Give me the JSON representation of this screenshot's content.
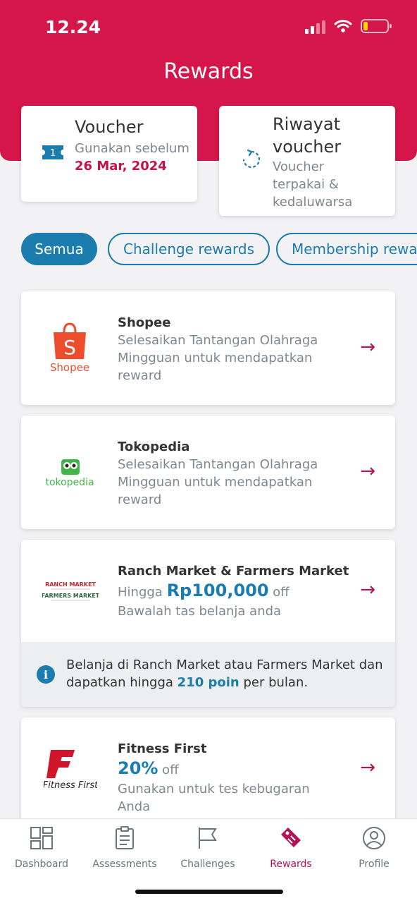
{
  "status_bar": {
    "time": "12.24"
  },
  "header": {
    "title": "Rewards"
  },
  "voucher_cards": [
    {
      "title": "Voucher",
      "sub_prefix": "Gunakan sebelum ",
      "date": "26 Mar, 2024",
      "icon": "ticket-icon",
      "badge": "1"
    },
    {
      "title": "Riwayat voucher",
      "sub": "Voucher terpakai & kedaluwarsa",
      "icon": "history-icon"
    }
  ],
  "filters": [
    {
      "label": "Semua",
      "active": true
    },
    {
      "label": "Challenge rewards",
      "active": false
    },
    {
      "label": "Membership rewa",
      "active": false
    }
  ],
  "rewards": [
    {
      "name": "Shopee",
      "desc": "Selesaikan Tantangan Olahraga Mingguan untuk mendapatkan reward",
      "logo_text": "Shopee",
      "logo_glyph": "S"
    },
    {
      "name": "Tokopedia",
      "desc": "Selesaikan Tantangan Olahraga Mingguan untuk mendapatkan reward",
      "logo_text": "tokopedia"
    },
    {
      "name": "Ranch Market & Farmers Market",
      "prefix": "Hingga ",
      "value": "Rp100,000",
      "suffix": " off",
      "desc": "Bawalah tas belanja anda",
      "logo_line1": "RANCH MARKET",
      "logo_line2": "FARMERS MARKET",
      "info_pre": "Belanja di Ranch Market atau Farmers Market dan dapatkan hingga ",
      "info_hl": "210 poin",
      "info_post": " per bulan."
    },
    {
      "name": "Fitness First",
      "value": "20%",
      "suffix": " off",
      "desc": "Gunakan untuk tes kebugaran Anda",
      "logo_text": "Fitness First"
    }
  ],
  "nav": [
    {
      "label": "Dashboard",
      "icon": "dashboard-icon"
    },
    {
      "label": "Assessments",
      "icon": "clipboard-icon"
    },
    {
      "label": "Challenges",
      "icon": "flag-icon"
    },
    {
      "label": "Rewards",
      "icon": "tag-icon",
      "active": true
    },
    {
      "label": "Profile",
      "icon": "profile-icon"
    }
  ],
  "colors": {
    "brand": "#d5164a",
    "accent_blue": "#1a7dae",
    "arrow": "#b1125a"
  }
}
